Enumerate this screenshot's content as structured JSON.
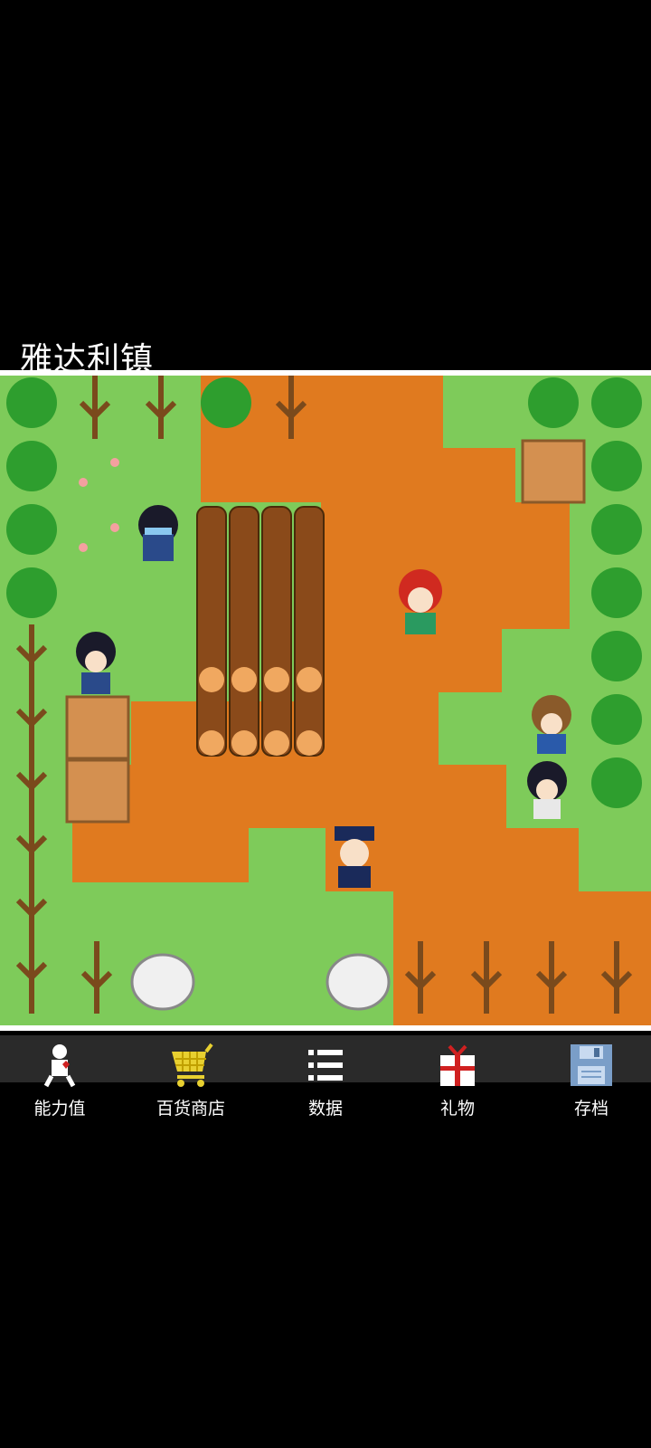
{
  "location": {
    "name": "雅达利镇"
  },
  "toolbar": {
    "items": [
      {
        "label": "能力值",
        "icon": "stats-figure-icon"
      },
      {
        "label": "百货商店",
        "icon": "shopping-cart-icon"
      },
      {
        "label": "数据",
        "icon": "list-icon"
      },
      {
        "label": "礼物",
        "icon": "gift-icon"
      },
      {
        "label": "存档",
        "icon": "save-disk-icon"
      }
    ]
  },
  "colors": {
    "grass": "#7ecb5a",
    "dirt": "#e07a1f",
    "tree": "#2e9e2e",
    "trunk": "#7a4a1c",
    "crate": "#d49050",
    "toolbar_bg": "#2a2a2a",
    "cart": "#e8d030",
    "gift_ribbon": "#d02020",
    "disk": "#7a9ec8"
  }
}
